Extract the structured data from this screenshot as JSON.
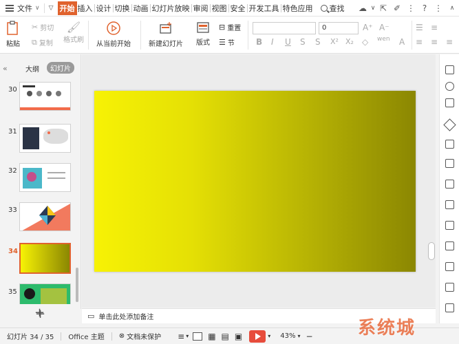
{
  "menubar": {
    "file_label": "文件",
    "tabs": [
      {
        "label": "开始",
        "active": true
      },
      {
        "label": "插入"
      },
      {
        "label": "设计"
      },
      {
        "label": "切换"
      },
      {
        "label": "动画"
      },
      {
        "label": "幻灯片放映"
      },
      {
        "label": "审阅"
      },
      {
        "label": "视图"
      },
      {
        "label": "安全"
      },
      {
        "label": "开发工具"
      },
      {
        "label": "特色应用"
      }
    ],
    "search_label": "查找",
    "accent_color": "#e0622d"
  },
  "ribbon": {
    "paste": "粘贴",
    "cut": "剪切",
    "copy": "复制",
    "format_painter": "格式刷",
    "play_from_current": "从当前开始",
    "new_slide": "新建幻灯片",
    "layout": "版式",
    "reset": "重置",
    "section": "节",
    "font_size_value": "0"
  },
  "leftpane": {
    "tab_outline": "大纲",
    "tab_slides": "幻灯片",
    "add_icon": "plus-icon",
    "thumbnails": [
      {
        "num": "30"
      },
      {
        "num": "31"
      },
      {
        "num": "32"
      },
      {
        "num": "33"
      },
      {
        "num": "34",
        "active": true
      },
      {
        "num": "35"
      }
    ]
  },
  "notes": {
    "placeholder": "单击此处添加备注"
  },
  "statusbar": {
    "slide_counter": "幻灯片 34 / 35",
    "theme": "Office 主题",
    "protection": "文档未保护",
    "zoom": "43%"
  },
  "watermark": {
    "text": "系统城"
  },
  "slide": {
    "gradient_start": "#f7f205",
    "gradient_end": "#8b8702"
  }
}
